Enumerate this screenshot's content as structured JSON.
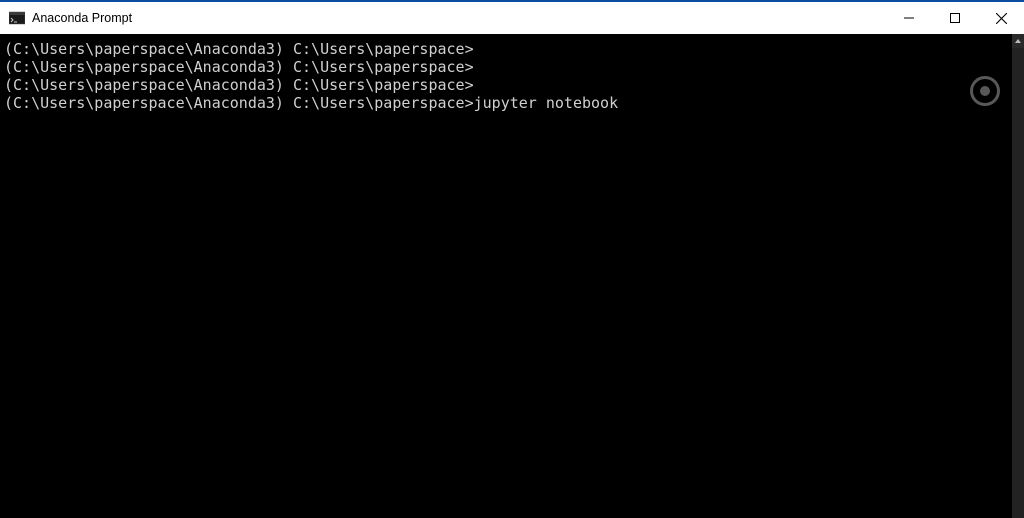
{
  "window": {
    "title": "Anaconda Prompt",
    "icon": "terminal-icon"
  },
  "terminal": {
    "text_color": "#d0d0d0",
    "background": "#000000",
    "prompt_env": "(C:\\Users\\paperspace\\Anaconda3)",
    "prompt_path": "C:\\Users\\paperspace>",
    "lines": [
      {
        "prompt": "(C:\\Users\\paperspace\\Anaconda3) C:\\Users\\paperspace>",
        "command": ""
      },
      {
        "prompt": "(C:\\Users\\paperspace\\Anaconda3) C:\\Users\\paperspace>",
        "command": ""
      },
      {
        "prompt": "(C:\\Users\\paperspace\\Anaconda3) C:\\Users\\paperspace>",
        "command": ""
      },
      {
        "prompt": "(C:\\Users\\paperspace\\Anaconda3) C:\\Users\\paperspace>",
        "command": "jupyter notebook"
      }
    ]
  }
}
